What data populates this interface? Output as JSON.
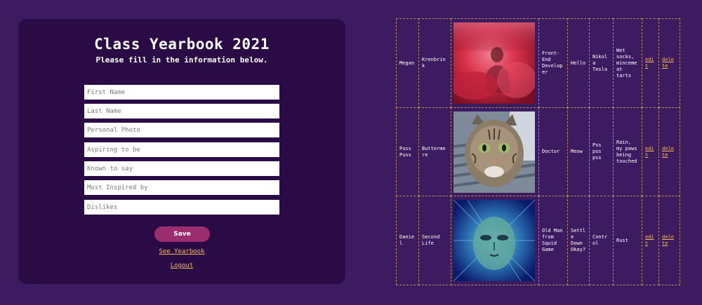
{
  "form": {
    "title": "Class Yearbook 2021",
    "subtitle": "Please fill in the information below.",
    "fields": [
      {
        "placeholder": "First Name"
      },
      {
        "placeholder": "Last Name"
      },
      {
        "placeholder": "Personal Photo"
      },
      {
        "placeholder": "Aspiring to be"
      },
      {
        "placeholder": "Known to say"
      },
      {
        "placeholder": "Most Inspired by"
      },
      {
        "placeholder": "Dislikes"
      }
    ],
    "save_label": "Save",
    "see_yearbook_label": "See Yearbook",
    "logout_label": "Logout"
  },
  "yearbook": {
    "rows": [
      {
        "first": "Megan",
        "last": "Krenbrink",
        "photo": "red-smoke-portrait",
        "aspiring": "Front-End Developer",
        "says": "Hello",
        "inspired": "Nikola Tesla",
        "dislikes": "Wet socks, mincemeat tarts",
        "edit": "edit",
        "delete": "delete"
      },
      {
        "first": "Puss Puss",
        "last": "Buttermere",
        "photo": "tabby-cat",
        "aspiring": "Doctor",
        "says": "Meow",
        "inspired": "Pss pss pss",
        "dislikes": "Rain, my paws being touched",
        "edit": "edit",
        "delete": "delete"
      },
      {
        "first": "Daniel",
        "last": "Second Life",
        "photo": "blue-alien-face",
        "aspiring": "Old Man from Squid Game",
        "says": "Settle Down Okay?",
        "inspired": "Control",
        "dislikes": "Rust",
        "edit": "edit",
        "delete": "delete"
      }
    ]
  },
  "colors": {
    "background": "#3d1b61",
    "panel": "#2a0b45",
    "accent_button": "#9b2c6e",
    "link": "#f4b85c",
    "grid_border": "#b38a5a"
  }
}
